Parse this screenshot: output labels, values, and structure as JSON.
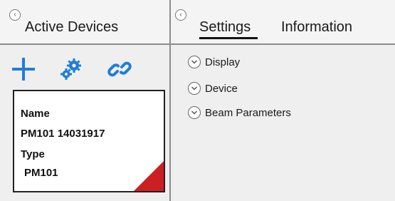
{
  "left": {
    "title": "Active Devices",
    "toolbar": {
      "add_icon": "plus-icon",
      "settings_icon": "gears-icon",
      "link_icon": "link-icon",
      "accent": "#1f7ed6"
    },
    "device": {
      "name_label": "Name",
      "name_value": "PM101 14031917",
      "type_label": "Type",
      "type_value": "PM101",
      "flag_color": "#cc1f24"
    }
  },
  "right": {
    "tabs": [
      {
        "label": "Settings",
        "active": true
      },
      {
        "label": "Information",
        "active": false
      }
    ],
    "sections": [
      {
        "label": "Display"
      },
      {
        "label": "Device"
      },
      {
        "label": "Beam Parameters"
      }
    ]
  }
}
